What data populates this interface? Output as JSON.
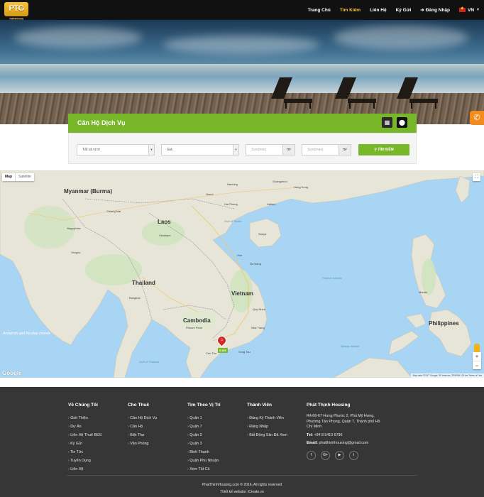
{
  "brand": {
    "logo_text": "PTG",
    "logo_tagline": "Phat Thinh Housing"
  },
  "nav": {
    "items": [
      {
        "label": "Trang Chủ",
        "active": false
      },
      {
        "label": "Tìm Kiếm",
        "active": true
      },
      {
        "label": "Liên Hệ",
        "active": false
      },
      {
        "label": "Ký Gửi",
        "active": false
      },
      {
        "label": "Đăng Nhập",
        "active": false
      }
    ],
    "language": "VN"
  },
  "search": {
    "title": "Căn Hộ Dịch Vụ",
    "location_value": "Tất cả vị trí",
    "price_value": "Giá",
    "size_min_placeholder": "Size(min)",
    "size_max_placeholder": "Size(max)",
    "unit": "m²",
    "button_label": "TÌM KIẾM"
  },
  "map": {
    "type_map": "Map",
    "type_satellite": "Satellite",
    "countries": [
      "Myanmar (Burma)",
      "Laos",
      "Thailand",
      "Cambodia",
      "Vietnam",
      "Philippines"
    ],
    "cities": [
      "Hanoi",
      "Hai Phong",
      "Vientiane",
      "Bangkok",
      "Phnom Penh",
      "Da Nang",
      "Hue",
      "Can Tho",
      "Vung Tau",
      "Manila",
      "Hong Kong",
      "Guangzhou",
      "Nanning",
      "Naypyidaw",
      "Yangon",
      "Chiang Mai",
      "Haikou",
      "Sanya",
      "Quy Nhon",
      "Nha Trang"
    ],
    "seas": [
      "Gulf of Tonkin",
      "Gulf of Thailand",
      "Andaman and Nicobar Islands",
      "Paracel Islands",
      "Spratly Islands"
    ],
    "marker_label": "$ 800",
    "attribution": "Map data ©2017 Google, SK telecom, ZENRIN   100 km   Terms of Use",
    "google": "Google"
  },
  "footer": {
    "about": {
      "title": "Về Chúng Tôi",
      "items": [
        "Giới Thiệu",
        "Dự Án",
        "Liên Hệ Thuê BĐS",
        "Ký Gửi",
        "Tin Tức",
        "Tuyển Dụng",
        "Liên Hệ"
      ]
    },
    "rent": {
      "title": "Cho Thuê",
      "items": [
        "Căn Hộ Dịch Vụ",
        "Căn Hộ",
        "Biệt Thự",
        "Văn Phòng"
      ]
    },
    "location": {
      "title": "Tìm Theo Vị Trí",
      "items": [
        "Quận 1",
        "Quận 7",
        "Quận 2",
        "Quận 3",
        "Bình Thạnh",
        "Quận Phú Nhuận",
        "Xem Tất Cả"
      ]
    },
    "member": {
      "title": "Thành Viên",
      "items": [
        "Đăng Ký Thành Viên",
        "Đăng Nhập",
        "Bất Động Sản Đã Xem"
      ]
    },
    "company": {
      "title": "Phát Thịnh Housing",
      "address": "R4.66-67 Hưng Phước 2, Phú Mỹ Hưng, Phường Tân Phong, Quận 7, Thành phố Hồ Chí Minh",
      "tel_label": "Tel:",
      "tel": "+84 8 5410 6796",
      "email_label": "Email:",
      "email": "phatthinhhousing@gmail.com"
    },
    "social": [
      "f",
      "G+",
      "▶",
      "t"
    ],
    "copyright": "PhatThinhHousing.com © 2016, All rights reserved",
    "design": "Thiết kế website: iCreate.vn"
  }
}
